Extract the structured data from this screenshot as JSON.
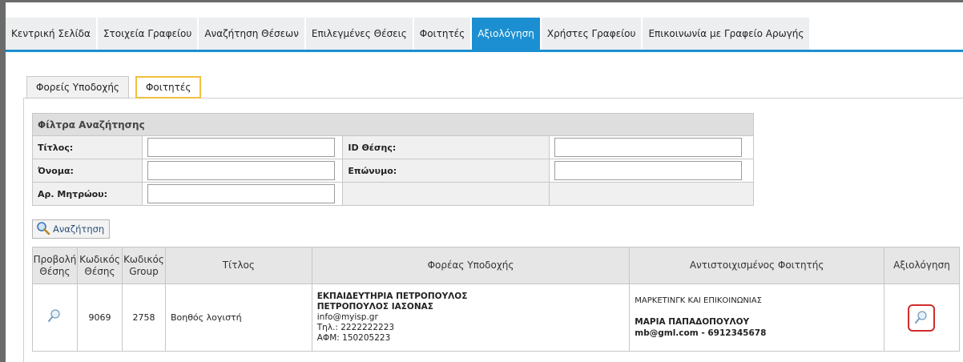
{
  "menu": {
    "tabs": [
      {
        "label": "Κεντρική Σελίδα",
        "active": false
      },
      {
        "label": "Στοιχεία Γραφείου",
        "active": false
      },
      {
        "label": "Αναζήτηση Θέσεων",
        "active": false
      },
      {
        "label": "Επιλεγμένες Θέσεις",
        "active": false
      },
      {
        "label": "Φοιτητές",
        "active": false
      },
      {
        "label": "Αξιολόγηση",
        "active": true
      },
      {
        "label": "Χρήστες Γραφείου",
        "active": false
      },
      {
        "label": "Επικοινωνία με Γραφείο Αρωγής",
        "active": false
      }
    ],
    "accent_color": "#1b8fd1"
  },
  "subtabs": [
    {
      "label": "Φορείς Υποδοχής",
      "active": false
    },
    {
      "label": "Φοιτητές",
      "active": true
    }
  ],
  "filters": {
    "title": "Φίλτρα Αναζήτησης",
    "title_label": "Τίτλος:",
    "title_value": "",
    "position_id_label": "ID Θέσης:",
    "position_id_value": "",
    "first_name_label": "Όνομα:",
    "first_name_value": "",
    "last_name_label": "Επώνυμο:",
    "last_name_value": "",
    "registry_label": "Αρ. Μητρώου:",
    "registry_value": ""
  },
  "search_button": {
    "label": "Αναζήτηση",
    "icon": "magnifier-icon"
  },
  "results": {
    "headers": {
      "view_line1": "Προβολή",
      "view_line2": "Θέσης",
      "code_line1": "Κωδικός",
      "code_line2": "Θέσης",
      "group_line1": "Κωδικός",
      "group_line2": "Group",
      "title": "Τίτλος",
      "host": "Φορέας Υποδοχής",
      "student": "Αντιστοιχισμένος Φοιτητής",
      "evaluation": "Αξιολόγηση"
    },
    "rows": [
      {
        "position_code": "9069",
        "group_code": "2758",
        "title": "Βοηθός λογιστή",
        "host_name": "ΕΚΠΑΙΔΕΥΤΗΡΙΑ ΠΕΤΡΟΠΟΥΛΟΣ",
        "host_contact_name": "ΠΕΤΡΟΠΟΥΛΟΣ ΙΑΣΟΝΑΣ",
        "host_email": "info@myisp.gr",
        "host_phone": "Τηλ.: 2222222223",
        "host_afm": "ΑΦΜ: 150205223",
        "student_program": "ΜΑΡΚΕΤΙΝΓΚ ΚΑΙ ΕΠΙΚΟΙΝΩΝΙΑΣ",
        "student_name": "ΜΑΡΙΑ ΠΑΠΑΔΟΠΟΥΛΟΥ",
        "student_contact": "mb@gml.com  -  6912345678"
      }
    ]
  }
}
